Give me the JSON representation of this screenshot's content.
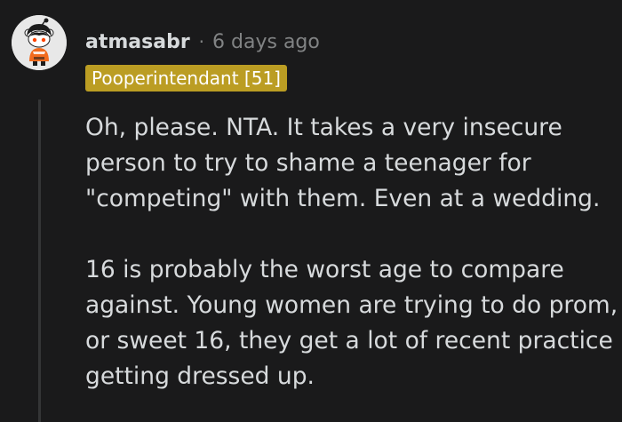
{
  "comment": {
    "username": "atmasabr",
    "separator": "·",
    "timestamp": "6 days ago",
    "flair": "Pooperintendant [51]",
    "paragraphs": [
      "Oh, please. NTA. It takes a very insecure person to try to shame a teenager for \"competing\" with them. Even at a wedding.",
      "16 is probably the worst age to compare against. Young women are trying to do prom, or sweet 16, they get a lot of recent practice getting dressed up."
    ]
  },
  "colors": {
    "background": "#1a1a1b",
    "text": "#d7dadc",
    "meta": "#818384",
    "flair_bg": "#bb9d23",
    "thread_line": "#343536"
  },
  "icons": {
    "avatar": "snoo-avatar-icon"
  }
}
